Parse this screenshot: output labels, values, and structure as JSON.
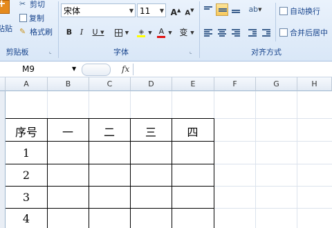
{
  "clipboard": {
    "paste_label": "粘贴",
    "cut_label": "剪切",
    "copy_label": "复制",
    "format_painter_label": "格式刷",
    "group_label": "剪贴板"
  },
  "font": {
    "family_value": "宋体",
    "size_value": "11",
    "grow_label": "A",
    "shrink_label": "A",
    "bold_label": "B",
    "italic_label": "I",
    "underline_label": "U",
    "phonetic_label": "变",
    "group_label": "字体"
  },
  "alignment": {
    "wrap_text_label": "自动换行",
    "merge_center_label": "合并后居中",
    "group_label": "对齐方式",
    "indent_dec_label": "讓",
    "indent_inc_label": "譯"
  },
  "formula_bar": {
    "name_box_value": "M9",
    "fx_label": "fx"
  },
  "columns": [
    "A",
    "B",
    "C",
    "D",
    "E",
    "F",
    "G",
    "H"
  ],
  "table": {
    "header": [
      "序号",
      "一",
      "二",
      "三",
      "四"
    ],
    "row_numbers": [
      "1",
      "2",
      "3",
      "4"
    ]
  },
  "colors": {
    "ribbon_label": "#15428b",
    "active_align": "#f7c85b",
    "font_color_bar": "#e01010",
    "fill_color_bar": "#ffff00"
  }
}
